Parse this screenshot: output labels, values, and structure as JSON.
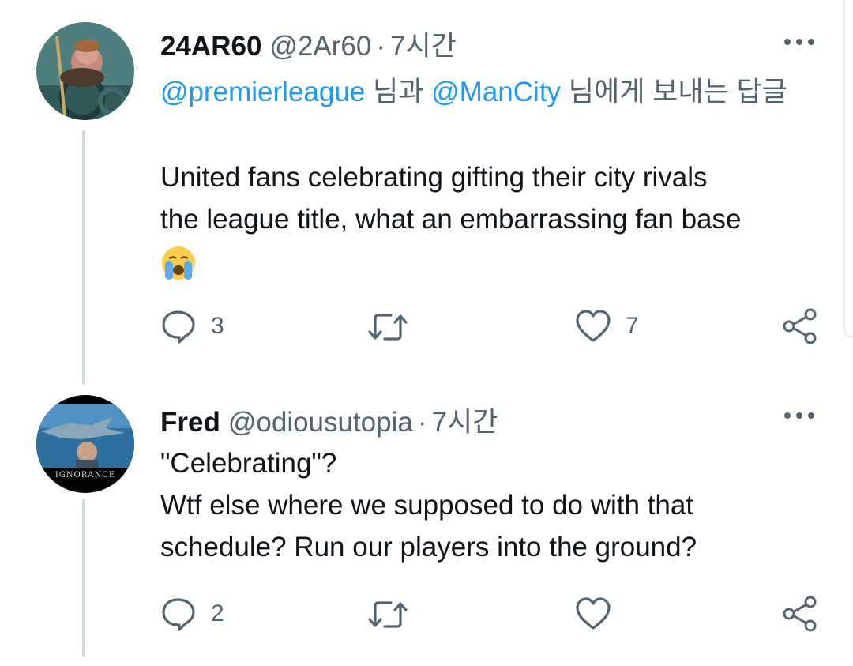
{
  "tweets": [
    {
      "display_name": "24AR60",
      "handle": "@2Ar60",
      "separator": "·",
      "time": "7시간",
      "replying": {
        "mention1": "@premierleague",
        "word1": "님과",
        "mention2": "@ManCity",
        "rest": "님에게 보내는 답글"
      },
      "text_line1": "United fans celebrating gifting their city rivals",
      "text_line2": "the league title, what an embarrassing fan base",
      "emoji": "loudly-crying-face",
      "replies": "3",
      "retweets": "",
      "likes": "7"
    },
    {
      "display_name": "Fred",
      "handle": "@odiousutopia",
      "separator": "·",
      "time": "7시간",
      "text_line1": "\"Celebrating\"?",
      "text_line2": "Wtf else where we supposed to do with that",
      "text_line3": "schedule? Run our players into the ground?",
      "avatar_caption": "IGNORANCE",
      "replies": "2",
      "retweets": "",
      "likes": ""
    }
  ],
  "colors": {
    "link": "#1d9bf0",
    "secondary": "#536471",
    "thread_line": "#cfd9de"
  }
}
